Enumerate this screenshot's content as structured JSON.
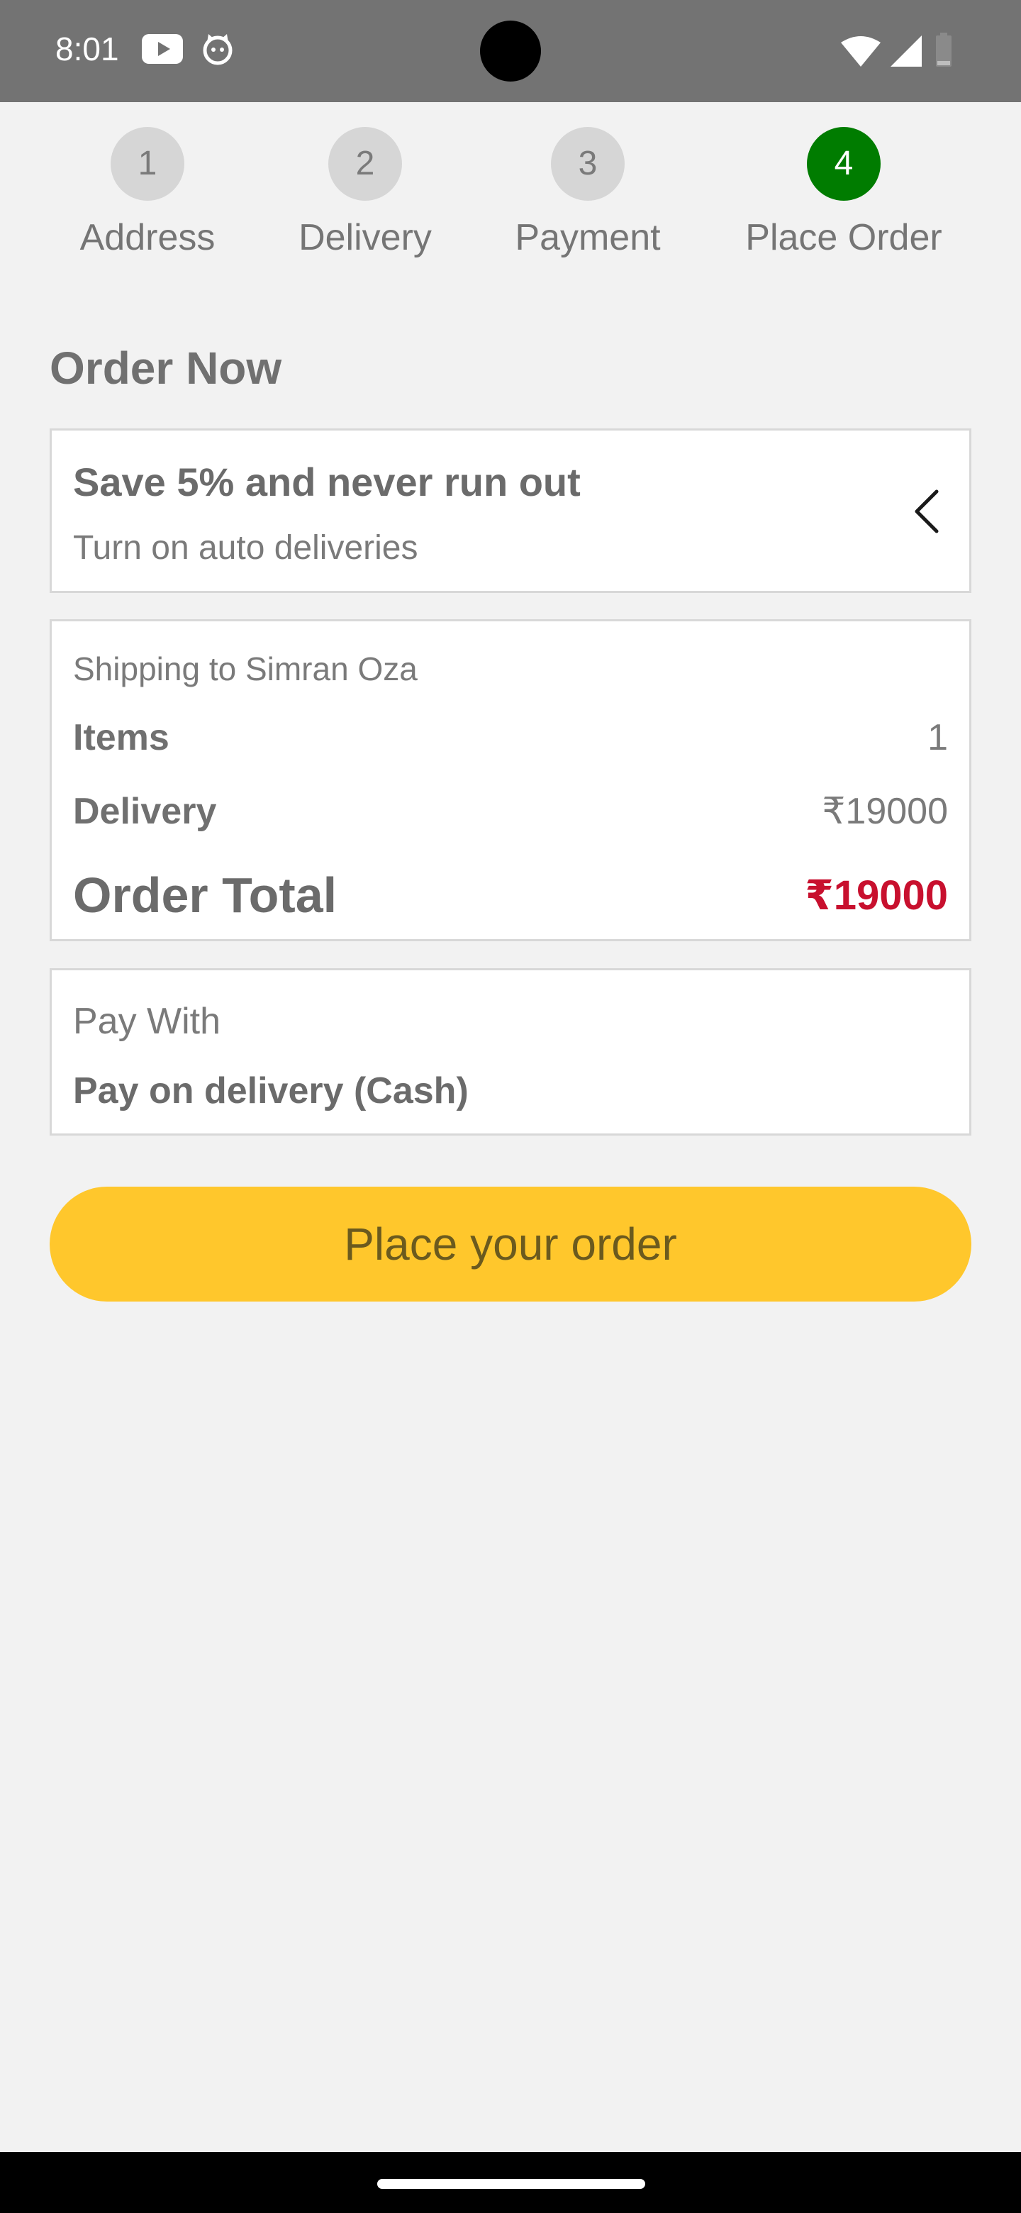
{
  "status_bar": {
    "time": "8:01",
    "icons": [
      "youtube-icon",
      "cat-face-icon",
      "wifi-icon",
      "signal-icon",
      "battery-icon"
    ]
  },
  "stepper": {
    "steps": [
      {
        "number": "1",
        "label": "Address",
        "active": false
      },
      {
        "number": "2",
        "label": "Delivery",
        "active": false
      },
      {
        "number": "3",
        "label": "Payment",
        "active": false
      },
      {
        "number": "4",
        "label": "Place Order",
        "active": true
      }
    ]
  },
  "page_title": "Order Now",
  "promo": {
    "title": "Save 5% and never run out",
    "subtitle": "Turn on auto deliveries",
    "icon": "chevron-left-icon"
  },
  "summary": {
    "shipping_to": "Shipping to Simran Oza",
    "items_label": "Items",
    "items_value": "1",
    "delivery_label": "Delivery",
    "delivery_value": "₹19000",
    "total_label": "Order Total",
    "total_value": "₹19000"
  },
  "payment": {
    "title": "Pay With",
    "method": "Pay on delivery (Cash)"
  },
  "place_order_button": "Place your order",
  "colors": {
    "active_step": "#007c00",
    "button": "#ffc72c",
    "total": "#c8102e",
    "status_bar": "#737373"
  }
}
